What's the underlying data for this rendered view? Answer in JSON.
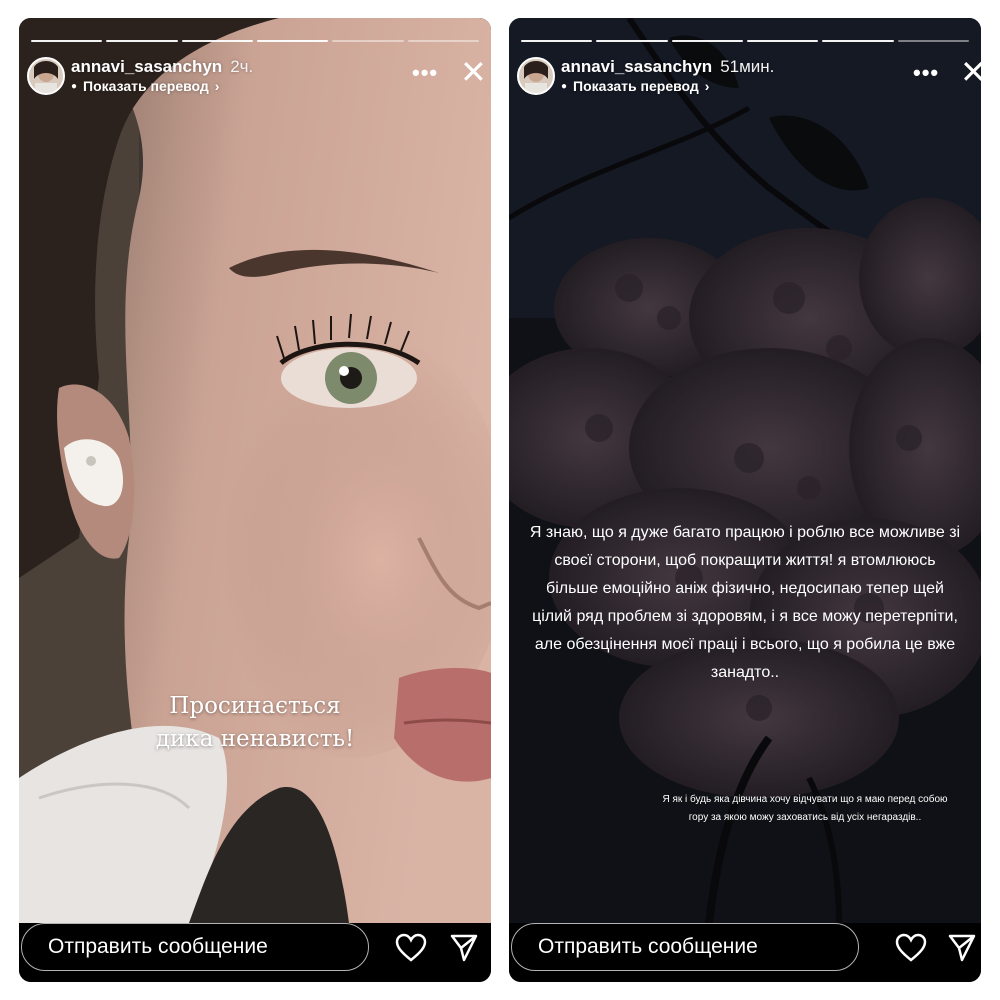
{
  "stories": [
    {
      "username": "annavi_sasanchyn",
      "time_ago": "2ч.",
      "translate_label": "Показать перевод",
      "caption": "Просинається дика ненависть!",
      "reply_placeholder": "Отправить сообщение"
    },
    {
      "username": "annavi_sasanchyn",
      "time_ago": "51мин.",
      "translate_label": "Показать перевод",
      "caption": "Я знаю, що я дуже багато працюю і роблю все можливе зі своєї сторони, щоб покращити життя! я втомлююсь більше емоційно аніж фізично, недосипаю тепер щей цілий ряд проблем зі здоровям, і я все можу перетерпіти, але обезцінення моєї праці і всього, що я робила це вже занадто..",
      "caption_small": "Я як і будь яка дівчина хочу відчувати що я маю перед собою гору за якою можу заховатись від усіх негараздів..",
      "reply_placeholder": "Отправить сообщение"
    }
  ],
  "icons": {
    "more": "more-horizontal-icon",
    "close": "close-icon",
    "like": "heart-icon",
    "share": "send-icon",
    "translate": "translate-icon",
    "chevron": "chevron-right-icon"
  }
}
